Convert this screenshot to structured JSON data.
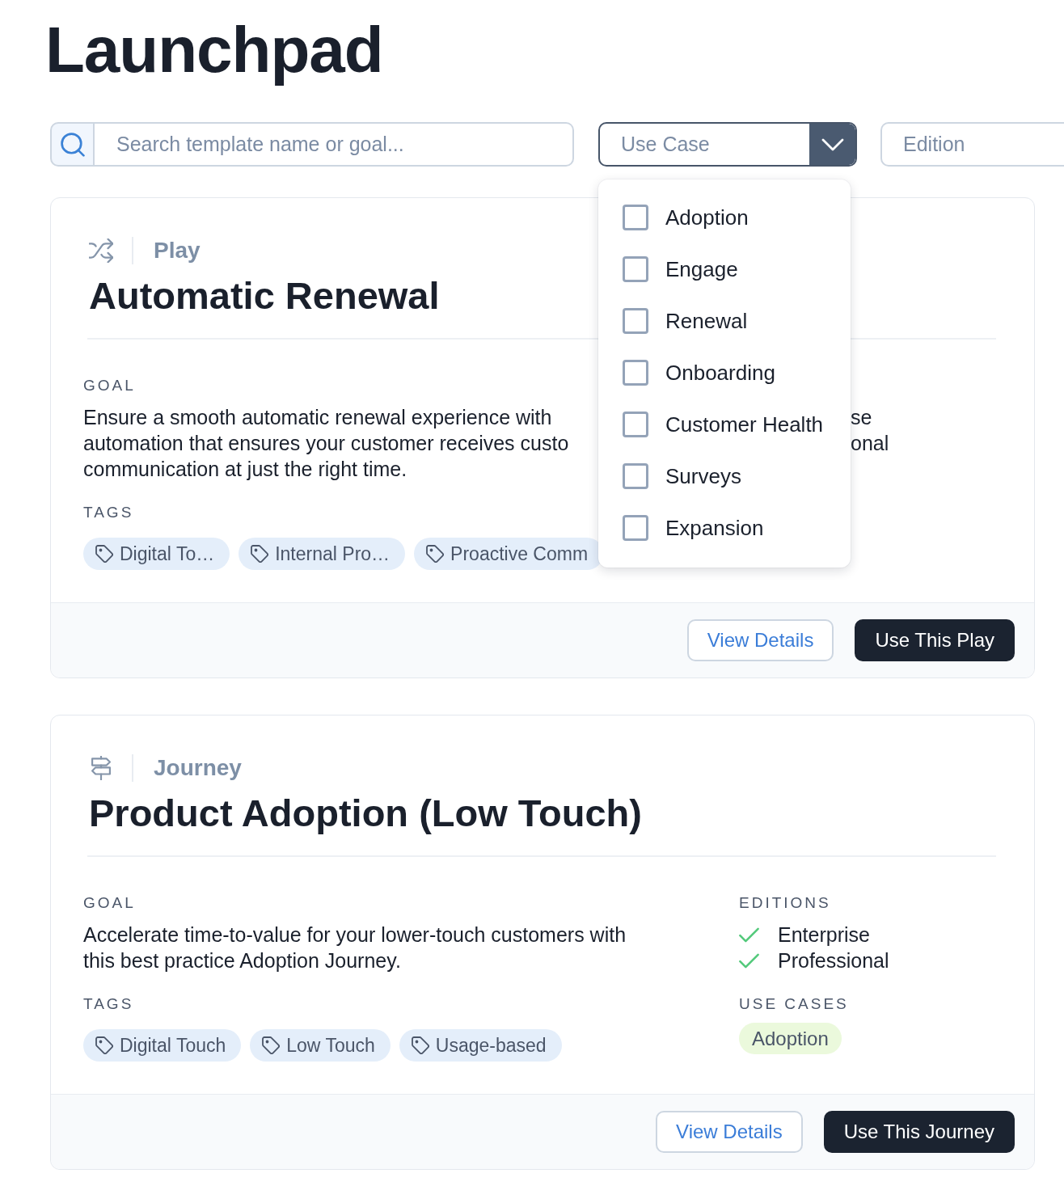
{
  "page": {
    "title": "Launchpad"
  },
  "filters": {
    "search": {
      "placeholder": "Search template name or goal..."
    },
    "use_case": {
      "placeholder": "Use Case",
      "expanded": true,
      "options": [
        {
          "label": "Adoption",
          "checked": false
        },
        {
          "label": "Engage",
          "checked": false
        },
        {
          "label": "Renewal",
          "checked": false
        },
        {
          "label": "Onboarding",
          "checked": false
        },
        {
          "label": "Customer Health",
          "checked": false
        },
        {
          "label": "Surveys",
          "checked": false
        },
        {
          "label": "Expansion",
          "checked": false
        }
      ]
    },
    "edition": {
      "placeholder": "Edition"
    }
  },
  "cards": [
    {
      "kind": "play",
      "type_label": "Play",
      "title": "Automatic Renewal",
      "goal_label": "GOAL",
      "goal": "Ensure a smooth automatic renewal experience with automation that ensures your customer receives custo communication at just the right time.",
      "editions_fragments": [
        "se",
        "onal"
      ],
      "tags_label": "TAGS",
      "tags": [
        "Digital To…",
        "Internal Pro…",
        "Proactive Comm"
      ],
      "buttons": {
        "secondary": "View Details",
        "primary": "Use This Play"
      }
    },
    {
      "kind": "journey",
      "type_label": "Journey",
      "title": "Product Adoption (Low Touch)",
      "goal_label": "GOAL",
      "goal": "Accelerate time-to-value for your lower-touch customers with this best practice Adoption Journey.",
      "editions": {
        "label": "EDITIONS",
        "items": [
          "Enterprise",
          "Professional"
        ]
      },
      "tags_label": "TAGS",
      "tags": [
        "Digital Touch",
        "Low Touch",
        "Usage-based"
      ],
      "use_cases": {
        "label": "USE CASES",
        "items": [
          "Adoption"
        ]
      },
      "buttons": {
        "secondary": "View Details",
        "primary": "Use This Journey"
      }
    }
  ]
}
